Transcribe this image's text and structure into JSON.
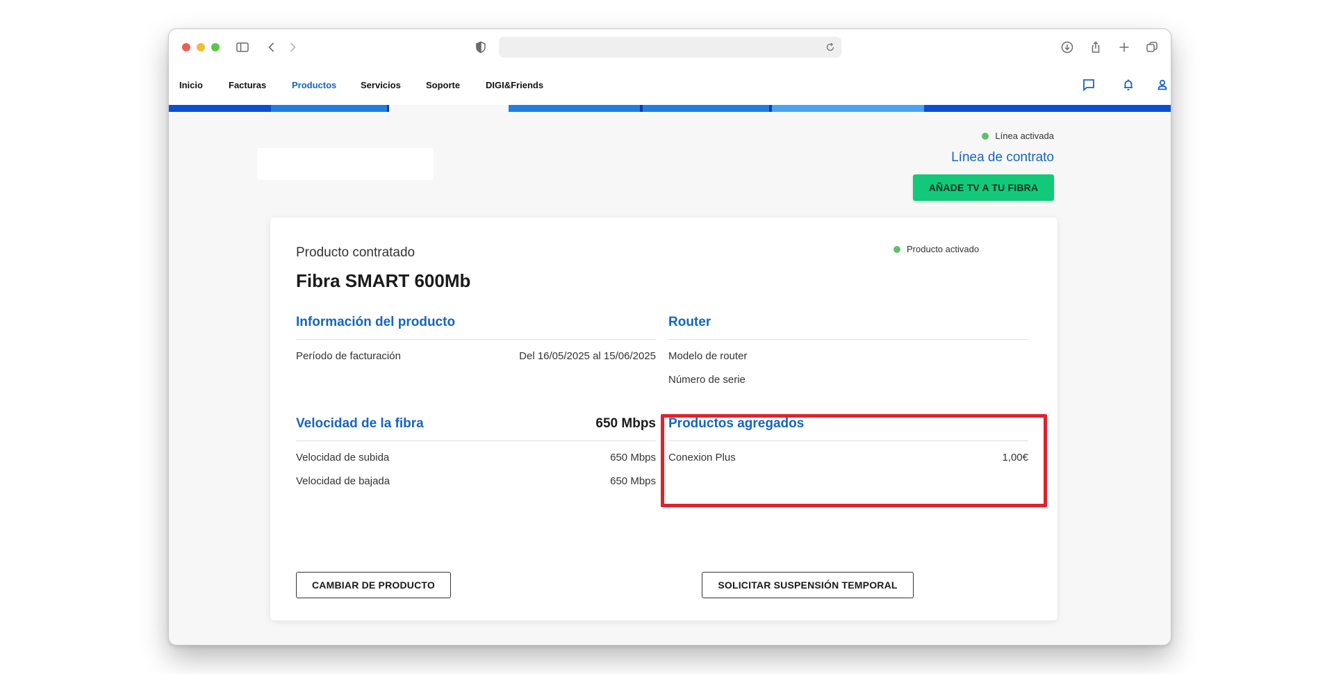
{
  "browser": {
    "url": ""
  },
  "nav": {
    "items": [
      {
        "label": "Inicio",
        "active": false
      },
      {
        "label": "Facturas",
        "active": false
      },
      {
        "label": "Productos",
        "active": true
      },
      {
        "label": "Servicios",
        "active": false
      },
      {
        "label": "Soporte",
        "active": false
      },
      {
        "label": "DIGI&Friends",
        "active": false
      }
    ]
  },
  "header": {
    "line_status": "Línea activada",
    "line_contract": "Línea de contrato",
    "add_tv_button": "AÑADE TV A TU FIBRA"
  },
  "product": {
    "label": "Producto contratado",
    "name": "Fibra SMART 600Mb",
    "status": "Producto activado",
    "info": {
      "title": "Información del producto",
      "rows": [
        {
          "label": "Período de facturación",
          "value": "Del 16/05/2025 al 15/06/2025"
        }
      ]
    },
    "router": {
      "title": "Router",
      "rows": [
        {
          "label": "Modelo de router",
          "value": ""
        },
        {
          "label": "Número de serie",
          "value": ""
        }
      ]
    },
    "speed": {
      "title": "Velocidad de la fibra",
      "value": "650 Mbps",
      "rows": [
        {
          "label": "Velocidad de subida",
          "value": "650 Mbps"
        },
        {
          "label": "Velocidad de bajada",
          "value": "650 Mbps"
        }
      ]
    },
    "addons": {
      "title": "Productos agregados",
      "rows": [
        {
          "label": "Conexion Plus",
          "value": "1,00€"
        }
      ]
    },
    "change_button": "CAMBIAR DE PRODUCTO",
    "suspend_button": "SOLICITAR SUSPENSIÓN TEMPORAL"
  },
  "colors": {
    "accent": "#1565c0",
    "green_button": "#12c97a",
    "status_dot": "#5cc26b",
    "highlight": "#e0222d"
  }
}
